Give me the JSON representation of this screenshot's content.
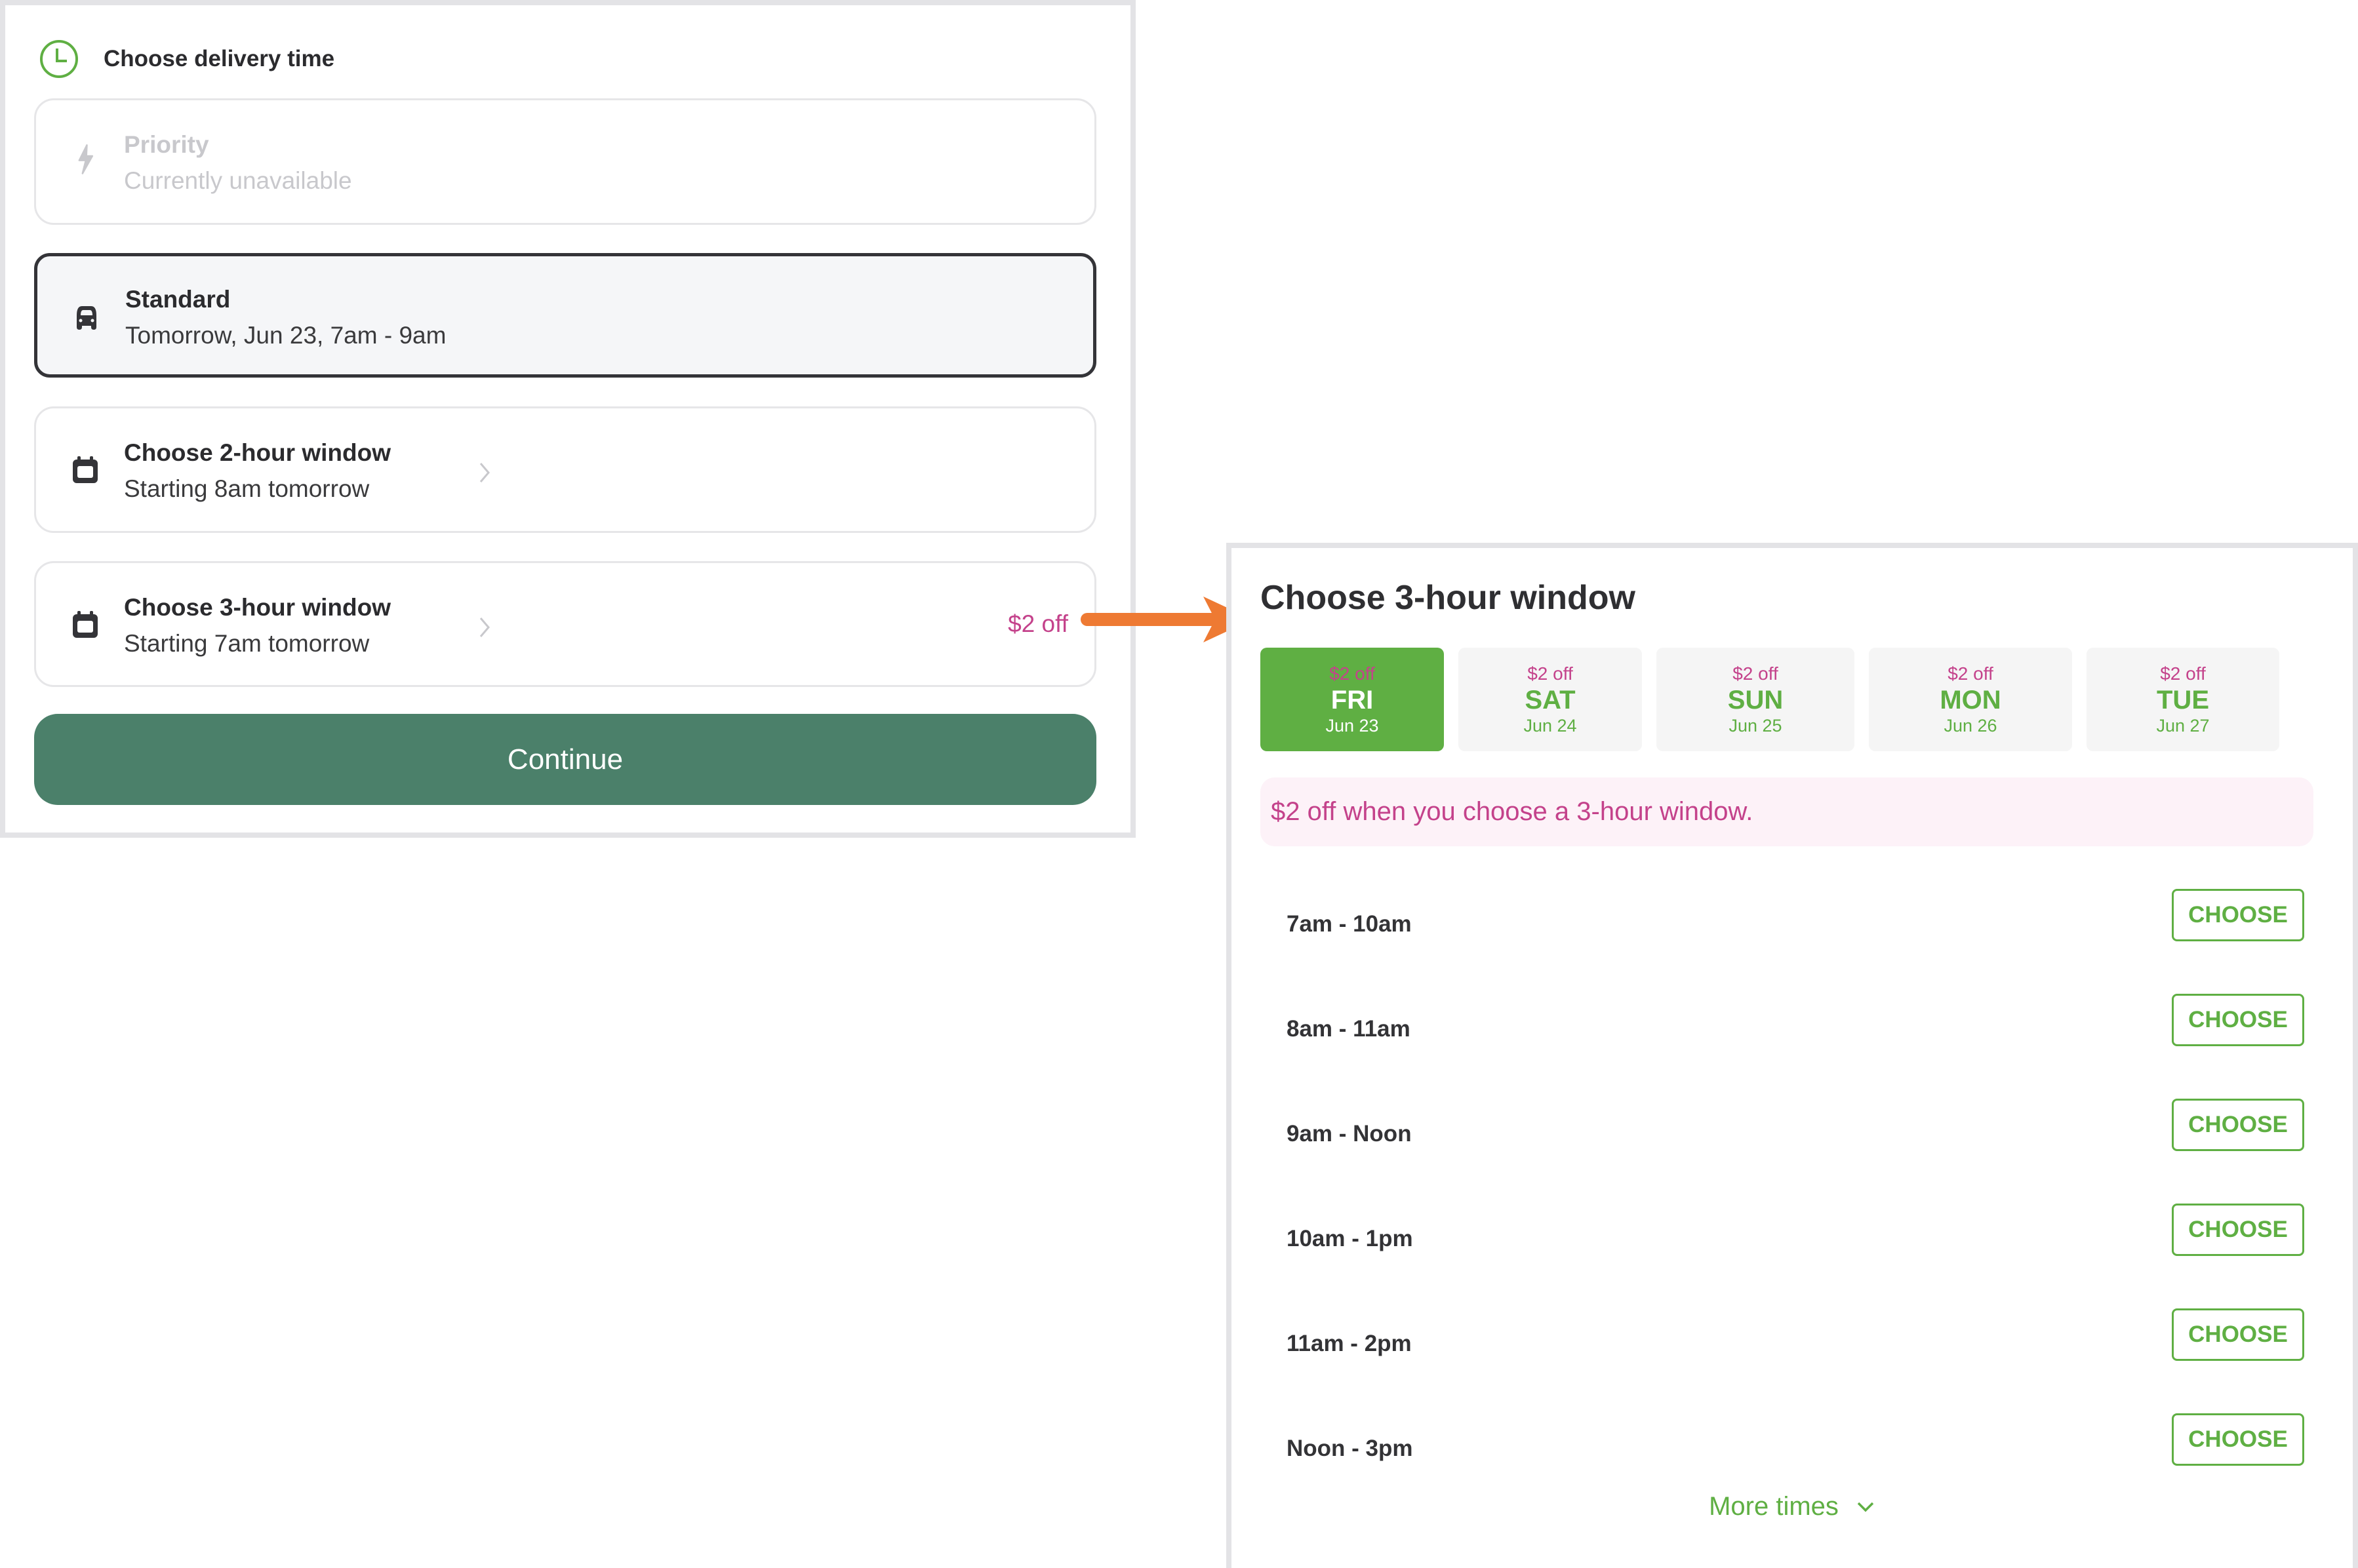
{
  "left": {
    "header": {
      "title": "Choose delivery time",
      "icon": "clock-icon"
    },
    "options": [
      {
        "id": "priority",
        "title": "Priority",
        "subtitle": "Currently unavailable",
        "icon": "lightning-icon",
        "state": "disabled"
      },
      {
        "id": "standard",
        "title": "Standard",
        "subtitle": "Tomorrow, Jun 23, 7am - 9am",
        "icon": "car-icon",
        "state": "selected"
      },
      {
        "id": "two-hour",
        "title": "Choose 2-hour window",
        "subtitle": "Starting 8am tomorrow",
        "icon": "calendar-icon",
        "state": "default"
      },
      {
        "id": "three-hour",
        "title": "Choose 3-hour window",
        "subtitle": "Starting 7am tomorrow",
        "icon": "calendar-icon",
        "state": "default",
        "promo": "$2 off"
      }
    ],
    "continue_label": "Continue"
  },
  "right": {
    "title": "Choose 3-hour window",
    "days": [
      {
        "promo": "$2 off",
        "day": "FRI",
        "date": "Jun 23",
        "active": true
      },
      {
        "promo": "$2 off",
        "day": "SAT",
        "date": "Jun 24",
        "active": false
      },
      {
        "promo": "$2 off",
        "day": "SUN",
        "date": "Jun 25",
        "active": false
      },
      {
        "promo": "$2 off",
        "day": "MON",
        "date": "Jun 26",
        "active": false
      },
      {
        "promo": "$2 off",
        "day": "TUE",
        "date": "Jun 27",
        "active": false
      }
    ],
    "promo_banner": "$2 off when you choose a 3-hour window.",
    "slots": [
      {
        "time": "7am - 10am",
        "action": "CHOOSE"
      },
      {
        "time": "8am - 11am",
        "action": "CHOOSE"
      },
      {
        "time": "9am - Noon",
        "action": "CHOOSE"
      },
      {
        "time": "10am - 1pm",
        "action": "CHOOSE"
      },
      {
        "time": "11am - 2pm",
        "action": "CHOOSE"
      },
      {
        "time": "Noon - 3pm",
        "action": "CHOOSE"
      }
    ],
    "more_label": "More times"
  },
  "colors": {
    "brand_green": "#5faf43",
    "continue_green": "#4b806a",
    "promo_pink": "#c4428b",
    "annotation_arrow": "#ee7a33"
  }
}
